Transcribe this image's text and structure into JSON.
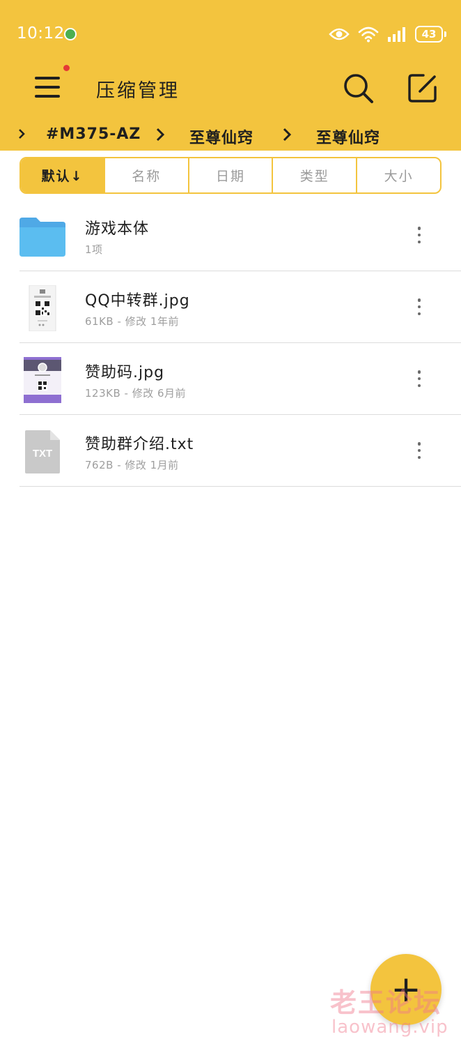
{
  "status_bar": {
    "time": "10:12",
    "battery": "43"
  },
  "toolbar": {
    "title": "压缩管理"
  },
  "breadcrumb": {
    "items": [
      "#M375-AZ",
      "至尊仙窍",
      "至尊仙窍"
    ]
  },
  "sort_tabs": {
    "items": [
      {
        "label": "默认↓",
        "active": true
      },
      {
        "label": "名称",
        "active": false
      },
      {
        "label": "日期",
        "active": false
      },
      {
        "label": "类型",
        "active": false
      },
      {
        "label": "大小",
        "active": false
      }
    ]
  },
  "files": [
    {
      "name": "游戏本体",
      "meta": "1项",
      "icon": "folder-icon"
    },
    {
      "name": "QQ中转群.jpg",
      "meta": "61KB - 修改 1年前",
      "icon": "image-thumbnail"
    },
    {
      "name": "赞助码.jpg",
      "meta": "123KB - 修改 6月前",
      "icon": "image-thumbnail"
    },
    {
      "name": "赞助群介绍.txt",
      "meta": "762B - 修改 1月前",
      "icon": "txt-file-icon",
      "badge": "TXT"
    }
  ],
  "fab": {
    "label": "+"
  },
  "watermark": {
    "cn": "老王论坛",
    "en": "laowang.vip"
  },
  "colors": {
    "accent": "#F3C43E",
    "folder": "#5BBDF0",
    "purple": "#8E6FD1"
  }
}
